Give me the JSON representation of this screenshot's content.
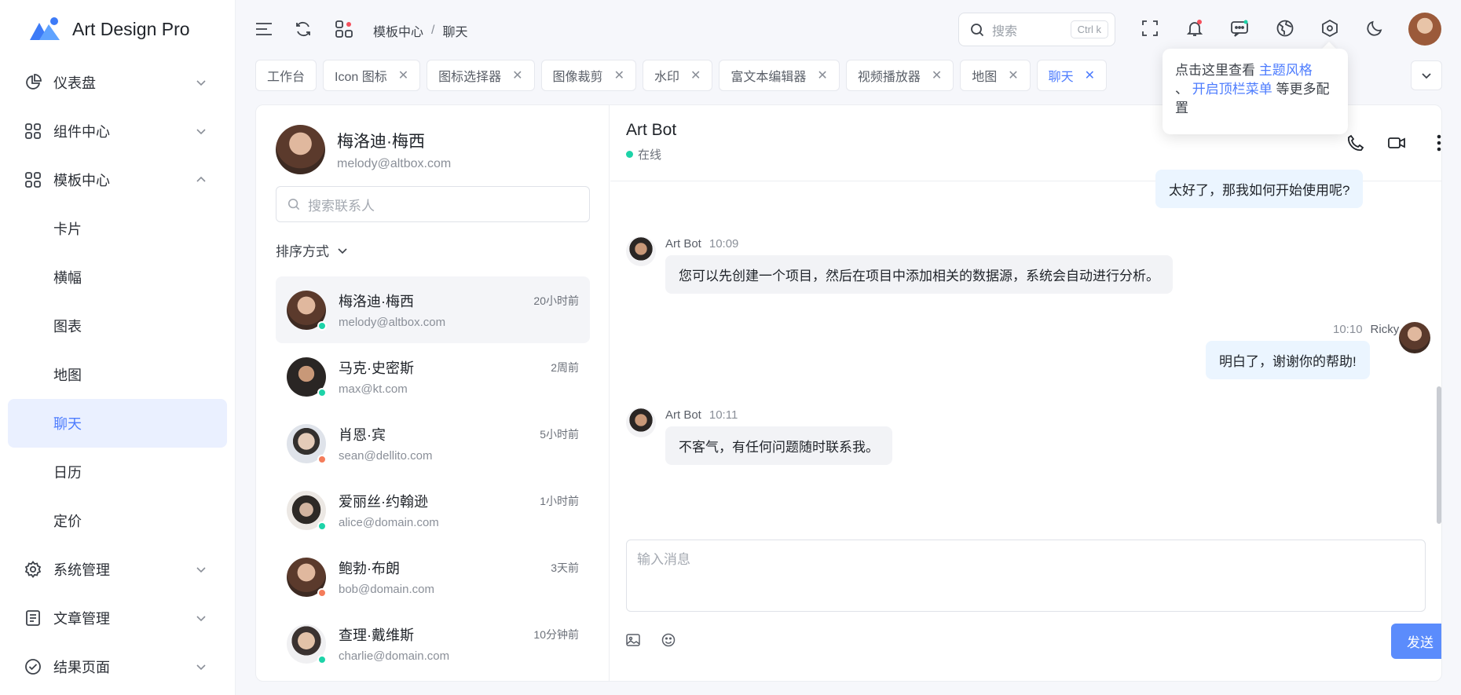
{
  "app": {
    "title": "Art Design Pro"
  },
  "sidebar": {
    "items": [
      {
        "label": "仪表盘",
        "icon": "pie-chart-icon",
        "expanded": false
      },
      {
        "label": "组件中心",
        "icon": "grid-icon",
        "expanded": false
      },
      {
        "label": "模板中心",
        "icon": "grid-icon",
        "expanded": true
      },
      {
        "label": "系统管理",
        "icon": "gear-icon",
        "expanded": false
      },
      {
        "label": "文章管理",
        "icon": "document-icon",
        "expanded": false
      },
      {
        "label": "结果页面",
        "icon": "check-circle-icon",
        "expanded": false
      }
    ],
    "sub_items": [
      "卡片",
      "横幅",
      "图表",
      "地图",
      "聊天",
      "日历",
      "定价"
    ],
    "active_sub": "聊天"
  },
  "header": {
    "breadcrumb": [
      "模板中心",
      "聊天"
    ],
    "search_placeholder": "搜索",
    "search_shortcut": "Ctrl k"
  },
  "tabs": [
    {
      "label": "工作台",
      "closable": false
    },
    {
      "label": "Icon 图标",
      "closable": true
    },
    {
      "label": "图标选择器",
      "closable": true
    },
    {
      "label": "图像裁剪",
      "closable": true
    },
    {
      "label": "水印",
      "closable": true
    },
    {
      "label": "富文本编辑器",
      "closable": true
    },
    {
      "label": "视频播放器",
      "closable": true
    },
    {
      "label": "地图",
      "closable": true
    },
    {
      "label": "聊天",
      "closable": true,
      "active": true
    }
  ],
  "tooltip": {
    "text1": "点击这里查看 ",
    "link1": "主题风格",
    "text2": "、 ",
    "link2": "开启顶栏菜单",
    "text3": " 等更多配置"
  },
  "profile": {
    "name": "梅洛迪·梅西",
    "email": "melody@altbox.com"
  },
  "contact_search_placeholder": "搜索联系人",
  "sort_label": "排序方式",
  "contacts": [
    {
      "name": "梅洛迪·梅西",
      "email": "melody@altbox.com",
      "time": "20小时前",
      "status": "online"
    },
    {
      "name": "马克·史密斯",
      "email": "max@kt.com",
      "time": "2周前",
      "status": "online"
    },
    {
      "name": "肖恩·宾",
      "email": "sean@dellito.com",
      "time": "5小时前",
      "status": "offline"
    },
    {
      "name": "爱丽丝·约翰逊",
      "email": "alice@domain.com",
      "time": "1小时前",
      "status": "online"
    },
    {
      "name": "鲍勃·布朗",
      "email": "bob@domain.com",
      "time": "3天前",
      "status": "offline"
    },
    {
      "name": "查理·戴维斯",
      "email": "charlie@domain.com",
      "time": "10分钟前",
      "status": "online"
    }
  ],
  "chat": {
    "title": "Art Bot",
    "status": "在线",
    "messages": [
      {
        "from": "Ricky",
        "text": "太好了，那我如何开始使用呢?",
        "side": "right"
      },
      {
        "from": "Art Bot",
        "time": "10:09",
        "text": "您可以先创建一个项目，然后在项目中添加相关的数据源，系统会自动进行分析。",
        "side": "left"
      },
      {
        "from": "Ricky",
        "time": "10:10",
        "text": "明白了，谢谢你的帮助!",
        "side": "right"
      },
      {
        "from": "Art Bot",
        "time": "10:11",
        "text": "不客气，有任何问题随时联系我。",
        "side": "left"
      }
    ],
    "input_placeholder": "输入消息",
    "send_label": "发送"
  },
  "colors": {
    "accent": "#4d7cfe",
    "online": "#1dd3a8",
    "offline": "#f47c5a",
    "send": "#5b8cfc"
  }
}
